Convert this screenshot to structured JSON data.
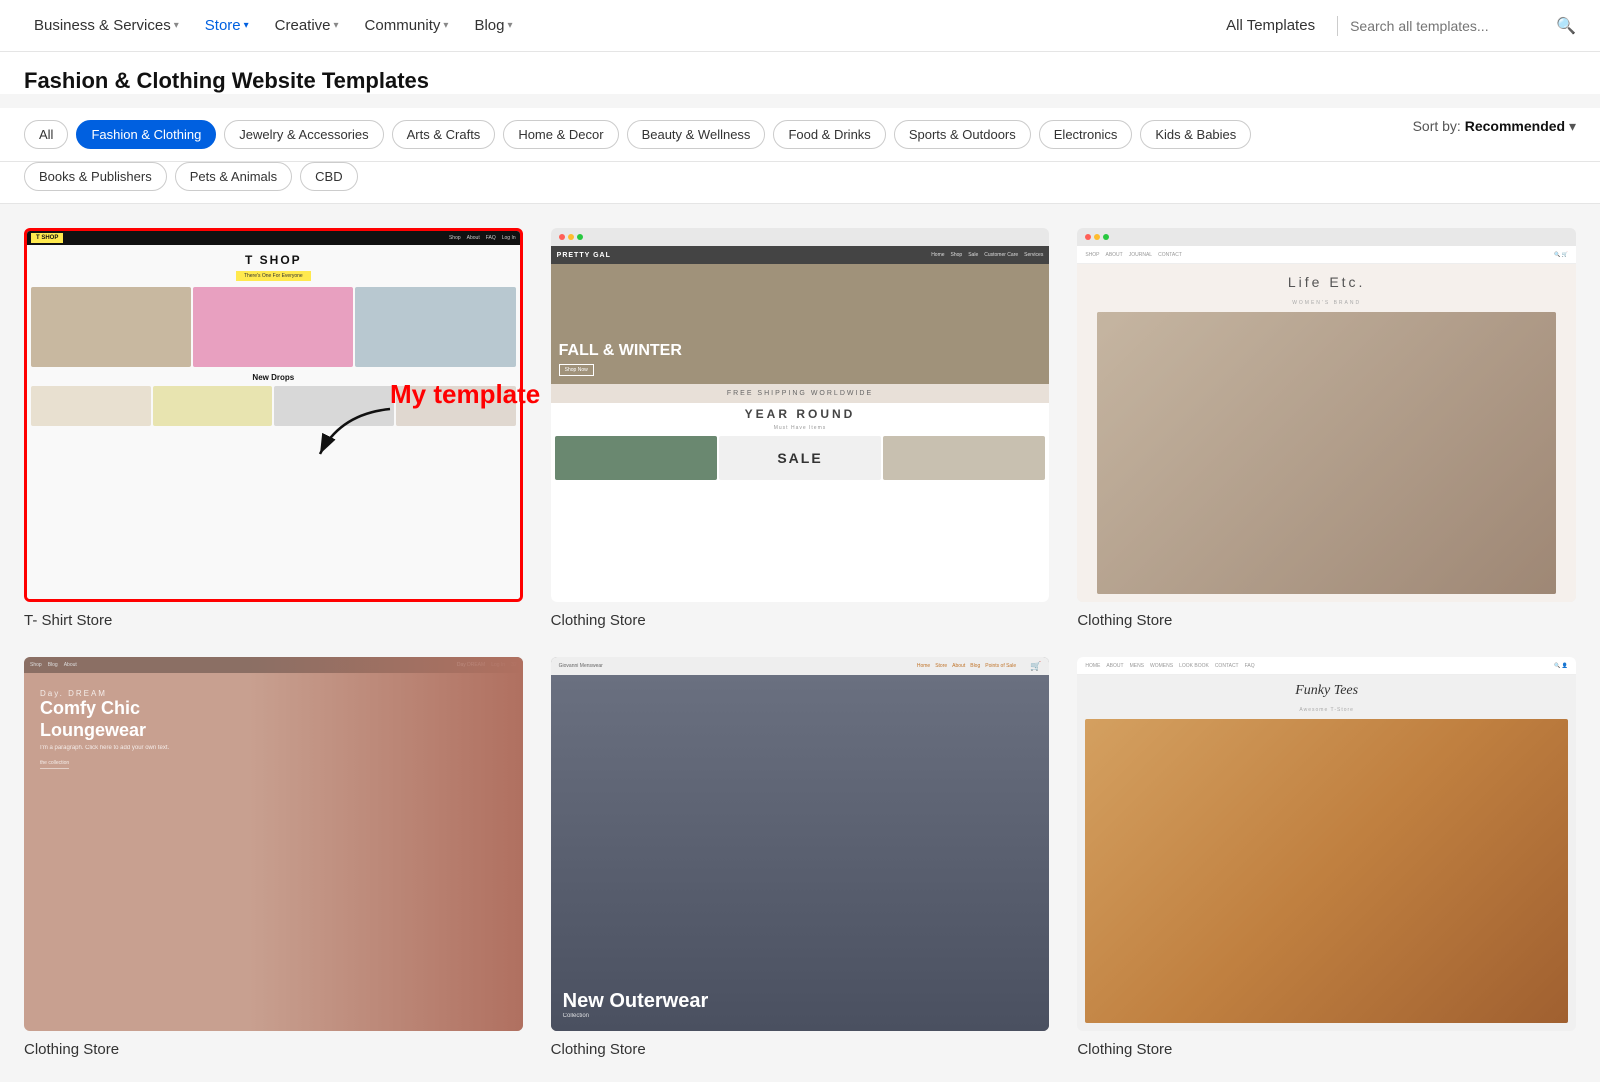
{
  "nav": {
    "items": [
      {
        "id": "business",
        "label": "Business & Services",
        "has_dropdown": true,
        "active": false
      },
      {
        "id": "store",
        "label": "Store",
        "has_dropdown": true,
        "active": true
      },
      {
        "id": "creative",
        "label": "Creative",
        "has_dropdown": true,
        "active": false
      },
      {
        "id": "community",
        "label": "Community",
        "has_dropdown": true,
        "active": false
      },
      {
        "id": "blog",
        "label": "Blog",
        "has_dropdown": true,
        "active": false
      }
    ],
    "all_templates": "All Templates",
    "search_placeholder": "Search all templates...",
    "search_icon": "🔍"
  },
  "page": {
    "title": "Fashion & Clothing Website Templates",
    "sort_label": "Sort by:",
    "sort_value": "Recommended"
  },
  "filters": {
    "row1": [
      {
        "id": "all",
        "label": "All",
        "active": false
      },
      {
        "id": "fashion",
        "label": "Fashion & Clothing",
        "active": true
      },
      {
        "id": "jewelry",
        "label": "Jewelry & Accessories",
        "active": false
      },
      {
        "id": "arts",
        "label": "Arts & Crafts",
        "active": false
      },
      {
        "id": "home",
        "label": "Home & Decor",
        "active": false
      },
      {
        "id": "beauty",
        "label": "Beauty & Wellness",
        "active": false
      },
      {
        "id": "food",
        "label": "Food & Drinks",
        "active": false
      },
      {
        "id": "sports",
        "label": "Sports & Outdoors",
        "active": false
      },
      {
        "id": "electronics",
        "label": "Electronics",
        "active": false
      },
      {
        "id": "kids",
        "label": "Kids & Babies",
        "active": false
      }
    ],
    "row2": [
      {
        "id": "books",
        "label": "Books & Publishers",
        "active": false
      },
      {
        "id": "pets",
        "label": "Pets & Animals",
        "active": false
      },
      {
        "id": "cbd",
        "label": "CBD",
        "active": false
      }
    ]
  },
  "annotation": {
    "label": "My template",
    "color": "red"
  },
  "templates": [
    {
      "id": "tshirt-store",
      "name": "T- Shirt Store",
      "highlighted": true,
      "type": "tshirt"
    },
    {
      "id": "clothing-store-1",
      "name": "Clothing Store",
      "highlighted": false,
      "type": "clothing1"
    },
    {
      "id": "clothing-store-2",
      "name": "Clothing Store",
      "highlighted": false,
      "type": "clothing2"
    },
    {
      "id": "loungewear",
      "name": "Clothing Store",
      "highlighted": false,
      "type": "loungewear"
    },
    {
      "id": "menswear",
      "name": "Clothing Store",
      "highlighted": false,
      "type": "menswear"
    },
    {
      "id": "funky-tees",
      "name": "Clothing Store",
      "highlighted": false,
      "type": "funky"
    }
  ]
}
